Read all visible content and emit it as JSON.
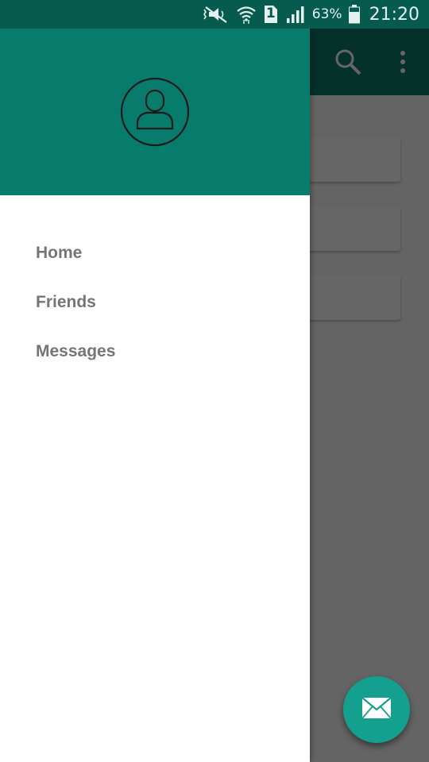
{
  "status_bar": {
    "icons": [
      "mute-icon",
      "wifi-icon",
      "sim-1-icon",
      "signal-icon",
      "battery-icon"
    ],
    "sim_label": "1",
    "battery_percent": "63%",
    "time": "21:20"
  },
  "toolbar": {
    "icons": [
      "search-icon",
      "overflow-menu-icon"
    ]
  },
  "drawer": {
    "avatar_icon": "user-icon",
    "menu": [
      {
        "label": "Home"
      },
      {
        "label": "Friends"
      },
      {
        "label": "Messages"
      }
    ]
  },
  "fab": {
    "icon": "mail-icon"
  },
  "colors": {
    "primary_dark": "#045b4e",
    "primary": "#077b6c",
    "accent": "#14a08e",
    "menu_text": "#757575"
  }
}
